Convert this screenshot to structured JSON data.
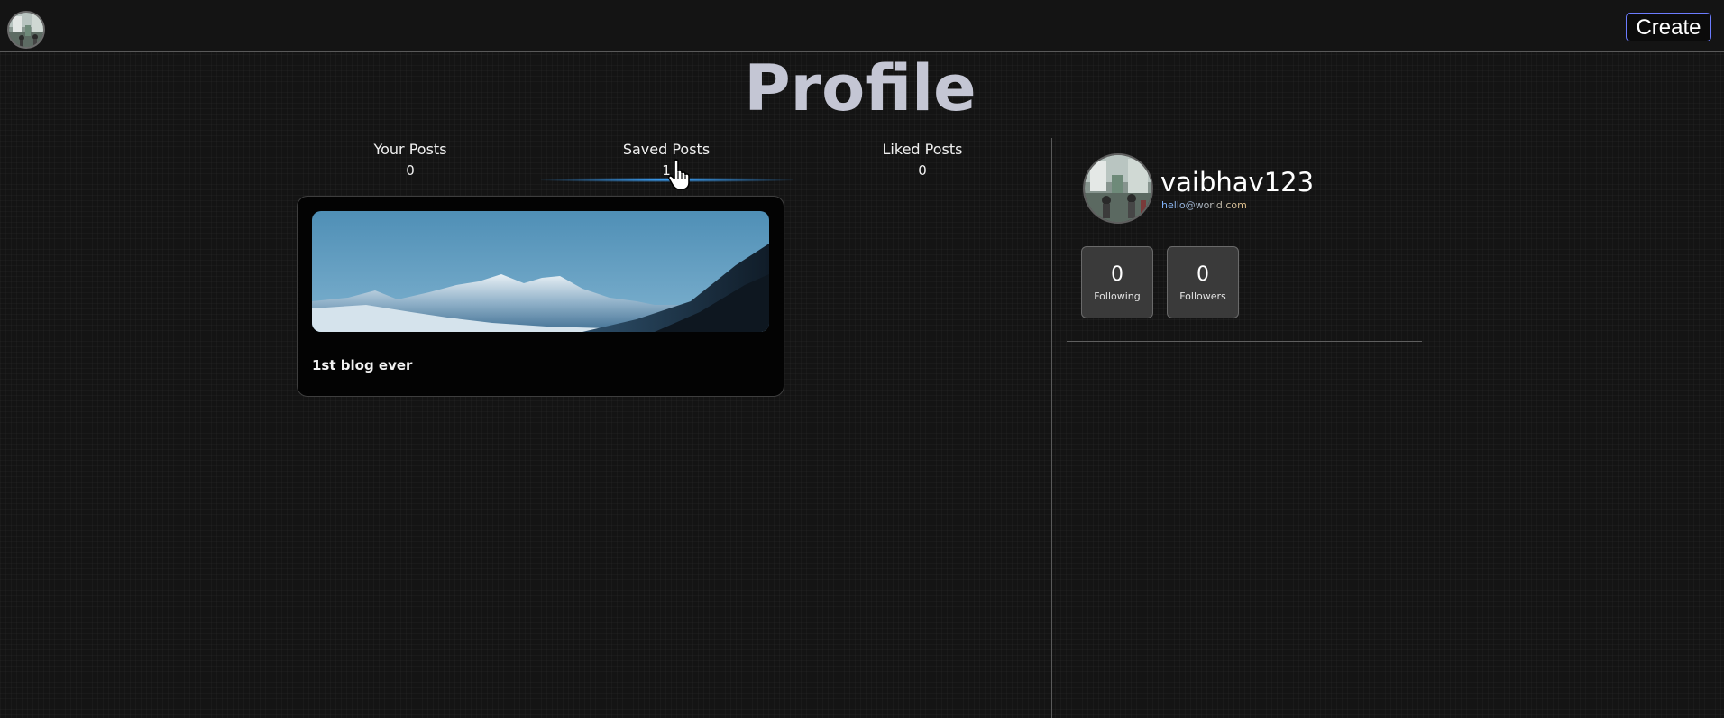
{
  "header": {
    "create_label": "Create",
    "avatar_icon": "user-avatar-photo"
  },
  "page": {
    "title": "Profile"
  },
  "tabs": [
    {
      "label": "Your Posts",
      "count": "0",
      "active": false
    },
    {
      "label": "Saved Posts",
      "count": "1",
      "active": true
    },
    {
      "label": "Liked Posts",
      "count": "0",
      "active": false
    }
  ],
  "posts": [
    {
      "title": "1st blog ever",
      "image": "mountain-landscape"
    }
  ],
  "profile": {
    "username": "vaibhav123",
    "email": "hello@world.com",
    "stats": [
      {
        "value": "0",
        "label": "Following"
      },
      {
        "value": "0",
        "label": "Followers"
      }
    ]
  },
  "colors": {
    "background": "#141414",
    "accent": "#3da5ff",
    "create_border": "#6c7cff",
    "title": "#c4c6d4"
  }
}
